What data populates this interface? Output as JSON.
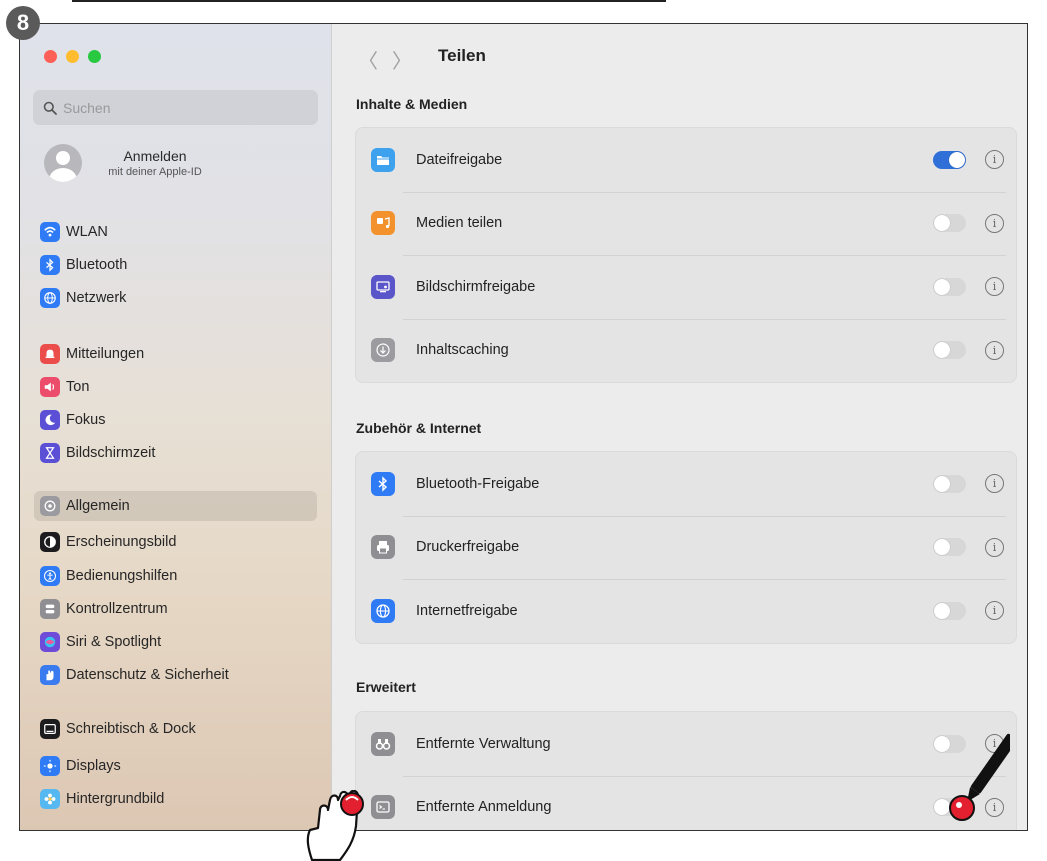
{
  "step_number": "8",
  "window": {
    "title": "Teilen",
    "search": {
      "placeholder": "Suchen"
    },
    "account": {
      "title": "Anmelden",
      "subtitle": "mit deiner Apple-ID"
    },
    "sidebar": [
      {
        "label": "WLAN",
        "icon": "wifi-icon",
        "color": "#2f7bf5"
      },
      {
        "label": "Bluetooth",
        "icon": "bluetooth-icon",
        "color": "#2f7bf5"
      },
      {
        "label": "Netzwerk",
        "icon": "globe-icon",
        "color": "#2f7bf5"
      },
      {
        "label": "Mitteilungen",
        "icon": "bell-icon",
        "color": "#eb4d4b"
      },
      {
        "label": "Ton",
        "icon": "speaker-icon",
        "color": "#eb4d6b"
      },
      {
        "label": "Fokus",
        "icon": "moon-icon",
        "color": "#5b4fd6"
      },
      {
        "label": "Bildschirmzeit",
        "icon": "hourglass-icon",
        "color": "#5b4fd6"
      },
      {
        "label": "Allgemein",
        "icon": "gear-icon",
        "color": "#9a9a9f",
        "active": true
      },
      {
        "label": "Erscheinungsbild",
        "icon": "appearance-icon",
        "color": "#1c1c1e"
      },
      {
        "label": "Bedienungshilfen",
        "icon": "accessibility-icon",
        "color": "#2f7bf5"
      },
      {
        "label": "Kontrollzentrum",
        "icon": "switches-icon",
        "color": "#8e8e93"
      },
      {
        "label": "Siri & Spotlight",
        "icon": "siri-icon",
        "color": "#6e4bd8"
      },
      {
        "label": "Datenschutz & Sicherheit",
        "icon": "hand-icon",
        "color": "#3a7cf0"
      },
      {
        "label": "Schreibtisch & Dock",
        "icon": "dock-icon",
        "color": "#1c1c1e"
      },
      {
        "label": "Displays",
        "icon": "sun-icon",
        "color": "#2f7bf5"
      },
      {
        "label": "Hintergrundbild",
        "icon": "flower-icon",
        "color": "#55b8f0"
      }
    ],
    "sections": [
      {
        "title": "Inhalte & Medien",
        "rows": [
          {
            "label": "Dateifreigabe",
            "icon": "folder-icon",
            "icon_color": "#3ea1ee",
            "enabled": true
          },
          {
            "label": "Medien teilen",
            "icon": "media-icon",
            "icon_color": "#f3922c",
            "enabled": false
          },
          {
            "label": "Bildschirmfreigabe",
            "icon": "screen-share-icon",
            "icon_color": "#5a55c8",
            "enabled": false
          },
          {
            "label": "Inhaltscaching",
            "icon": "download-circle-icon",
            "icon_color": "#9b9ba0",
            "enabled": false
          }
        ]
      },
      {
        "title": "Zubehör & Internet",
        "rows": [
          {
            "label": "Bluetooth-Freigabe",
            "icon": "bluetooth-icon",
            "icon_color": "#2f7bf5",
            "enabled": false
          },
          {
            "label": "Druckerfreigabe",
            "icon": "printer-icon",
            "icon_color": "#8e8e93",
            "enabled": false
          },
          {
            "label": "Internetfreigabe",
            "icon": "globe-icon",
            "icon_color": "#2f7bf5",
            "enabled": false
          }
        ]
      },
      {
        "title": "Erweitert",
        "rows": [
          {
            "label": "Entfernte Verwaltung",
            "icon": "binoculars-icon",
            "icon_color": "#8e8e93",
            "enabled": false
          },
          {
            "label": "Entfernte Anmeldung",
            "icon": "terminal-icon",
            "icon_color": "#8e8e93",
            "enabled": false
          }
        ]
      }
    ],
    "info_glyph": "i"
  },
  "colors": {
    "accent": "#2e6fd8",
    "annotation": "#e2202f"
  }
}
